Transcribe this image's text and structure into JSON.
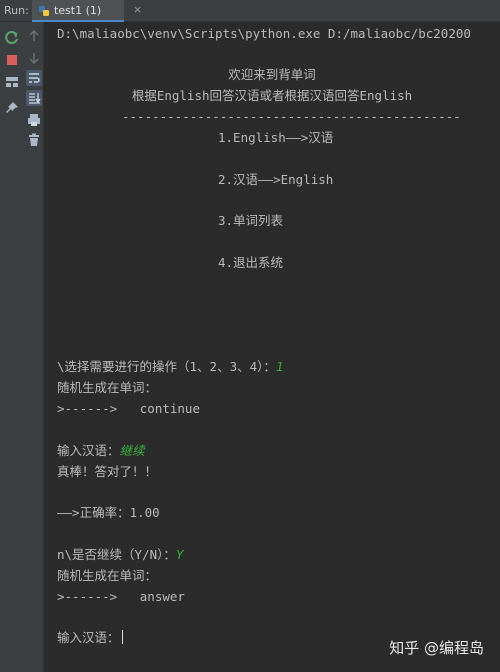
{
  "run_panel": {
    "label": "Run:",
    "tab_title": "test1 (1)",
    "tab_close": "×"
  },
  "toolbar": {
    "icons": [
      "rerun-icon",
      "stop-icon",
      "up-arrow-icon",
      "down-arrow-icon",
      "soft-wrap-icon",
      "scroll-to-end-icon",
      "layout-icon",
      "print-icon",
      "pin-icon",
      "trash-icon"
    ]
  },
  "console": {
    "command": "D:\\maliaobc\\venv\\Scripts\\python.exe D:/maliaobc/bc20200",
    "welcome": "欢迎来到背单词",
    "instructions": "根据English回答汉语或者根据汉语回答English",
    "divider": "---------------------------------------------",
    "menu": [
      "1.English——>汉语",
      "2.汉语——>English",
      "3.单词列表",
      "4.退出系统"
    ],
    "select_prompt": "\\选择需要进行的操作（1、2、3、4）：",
    "select_input": "1",
    "gen_word_1": "随机生成在单词：",
    "word_1": ">------>   continue",
    "answer_prompt_1": "输入汉语：",
    "answer_input_1": "继续",
    "correct_msg": "真棒！答对了！！",
    "accuracy": "——>正确率：1.00",
    "continue_prompt": "n\\是否继续（Y/N）：",
    "continue_input": "Y",
    "gen_word_2": "随机生成在单词：",
    "word_2": ">------>   answer",
    "answer_prompt_2": "输入汉语："
  },
  "watermark": "知乎 @编程岛",
  "colors": {
    "background": "#2b2b2b",
    "panel": "#3c3f41",
    "text": "#bbbbbb",
    "user_input": "#38b039",
    "accent": "#4a88c7"
  }
}
